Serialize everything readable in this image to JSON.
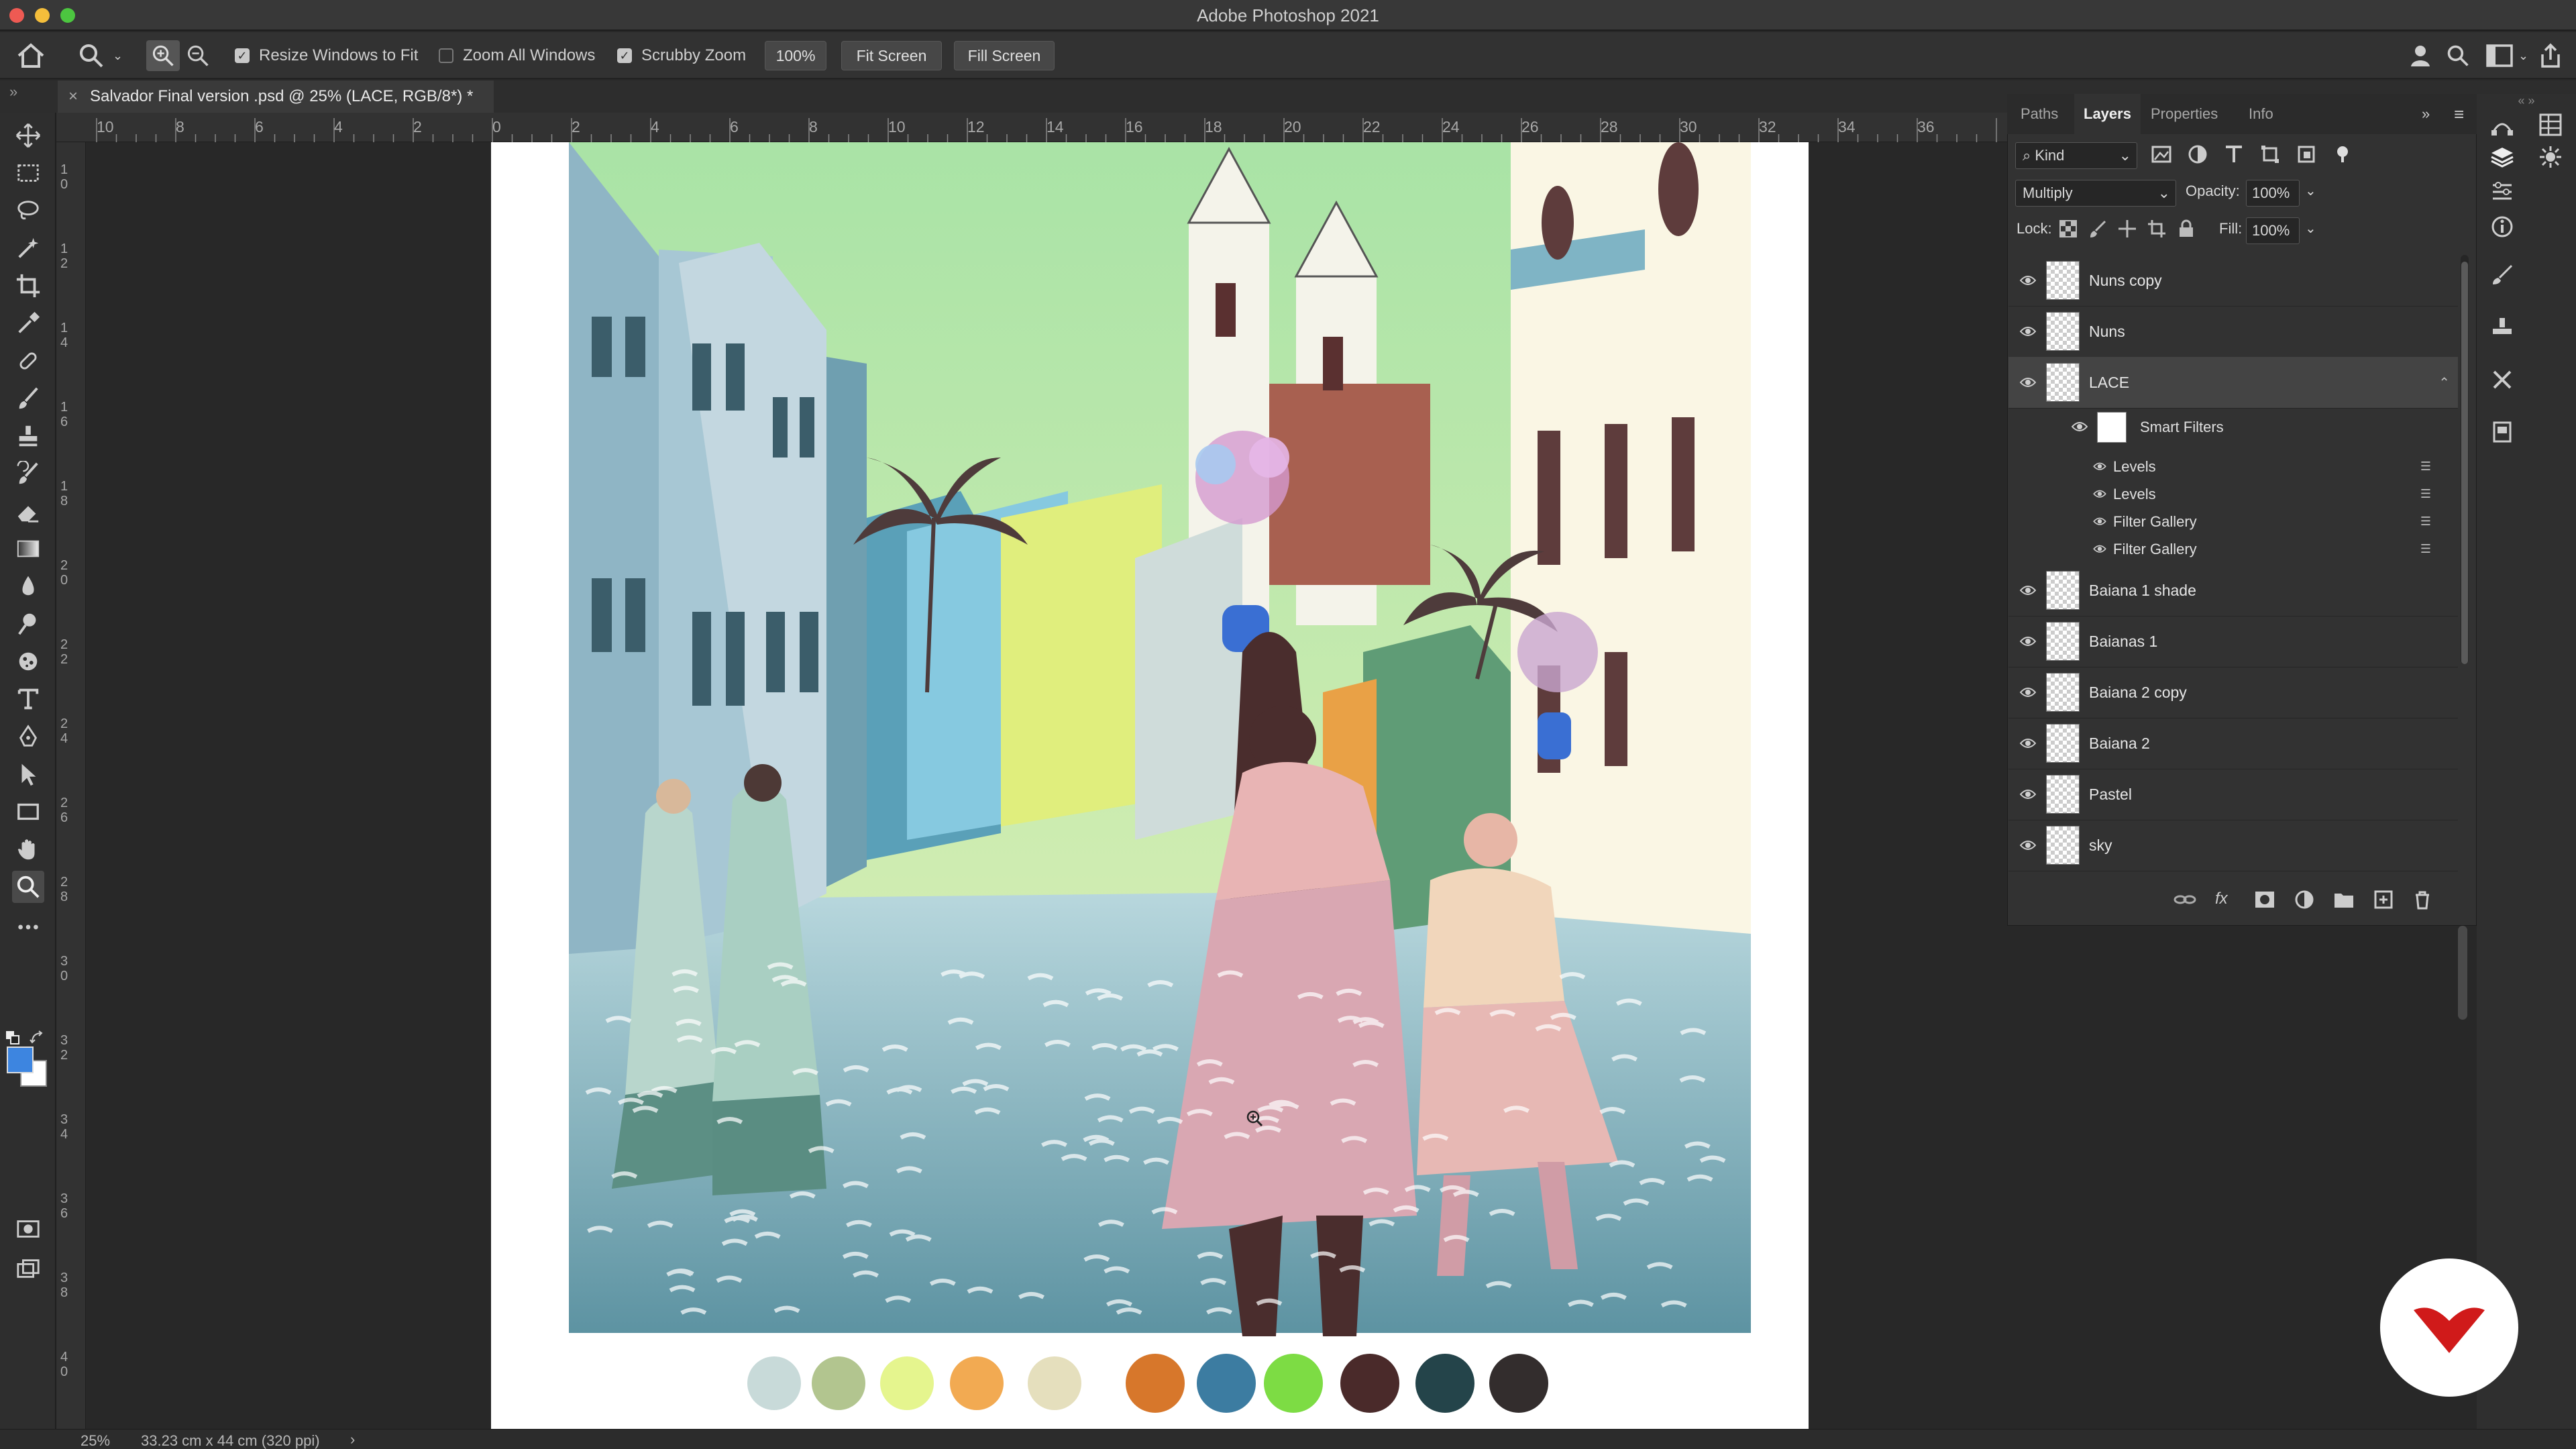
{
  "app": {
    "title": "Adobe Photoshop 2021"
  },
  "options": {
    "resize_label": "Resize Windows to Fit",
    "zoom_all_label": "Zoom All Windows",
    "scrubby_label": "Scrubby Zoom",
    "zoom_value": "100%",
    "fit_label": "Fit Screen",
    "fill_label": "Fill Screen"
  },
  "document": {
    "close": "×",
    "tab_title": "Salvador Final version .psd @ 25% (LACE, RGB/8*) *"
  },
  "ruler": {
    "h": [
      "10",
      "8",
      "6",
      "4",
      "2",
      "0",
      "2",
      "4",
      "6",
      "8",
      "10",
      "12",
      "14",
      "16",
      "18",
      "20",
      "22",
      "24",
      "26",
      "28",
      "30",
      "32",
      "34",
      "36"
    ],
    "v": [
      "1 0",
      "1 2",
      "1 4",
      "1 6",
      "1 8",
      "2 0",
      "2 2",
      "2 4",
      "2 6",
      "2 8",
      "3 0",
      "3 2",
      "3 4",
      "3 6",
      "3 8",
      "4 0"
    ]
  },
  "panel": {
    "tabs": [
      "Paths",
      "Layers",
      "Properties",
      "Info"
    ],
    "active_tab": "Layers",
    "filter_kind": "Kind",
    "blend_mode": "Multiply",
    "opacity_label": "Opacity:",
    "opacity": "100%",
    "lock_label": "Lock:",
    "fill_label": "Fill:",
    "fill": "100%"
  },
  "layers": [
    {
      "name": "Nuns copy"
    },
    {
      "name": "Nuns"
    },
    {
      "name": "LACE",
      "selected": true
    },
    {
      "name": "Baiana 1 shade"
    },
    {
      "name": "Baianas 1"
    },
    {
      "name": "Baiana 2 copy"
    },
    {
      "name": "Baiana 2"
    },
    {
      "name": "Pastel"
    },
    {
      "name": "sky"
    }
  ],
  "smart_filters": {
    "label": "Smart Filters",
    "items": [
      "Levels",
      "Levels",
      "Filter Gallery",
      "Filter Gallery"
    ]
  },
  "palette": [
    "#c8dad9",
    "#b2c58f",
    "#e5f58e",
    "#f2aa52",
    "#e5dfbd",
    "#d7772b",
    "#3c7ca1",
    "#7ddc44",
    "#4a2a2a",
    "#24444a",
    "#332d2d"
  ],
  "status": {
    "zoom": "25%",
    "doc_size": "33.23 cm x 44 cm (320 ppi)",
    "arrow": "›"
  }
}
